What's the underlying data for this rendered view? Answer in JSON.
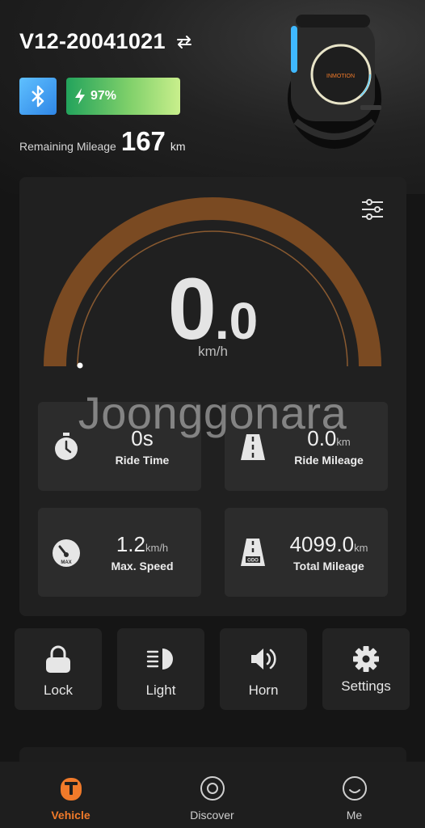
{
  "header": {
    "device_name": "V12-20041021",
    "battery_percent": "97%",
    "remaining_mileage_label": "Remaining Mileage",
    "remaining_mileage_value": "167",
    "remaining_mileage_unit": "km"
  },
  "gauge": {
    "speed_integer": "0",
    "speed_decimal": ".0",
    "speed_unit": "km/h",
    "arc_color": "#7a4a22"
  },
  "stats": [
    {
      "value": "0s",
      "unit": "",
      "label": "Ride Time",
      "icon": "stopwatch-icon"
    },
    {
      "value": "0.0",
      "unit": "km",
      "label": "Ride Mileage",
      "icon": "road-icon"
    },
    {
      "value": "1.2",
      "unit": "km/h",
      "label": "Max. Speed",
      "icon": "speedometer-max-icon"
    },
    {
      "value": "4099.0",
      "unit": "km",
      "label": "Total Mileage",
      "icon": "road-odo-icon"
    }
  ],
  "watermark": "Joonggonara",
  "controls": [
    {
      "label": "Lock",
      "icon": "lock-icon"
    },
    {
      "label": "Light",
      "icon": "headlight-icon"
    },
    {
      "label": "Horn",
      "icon": "horn-icon"
    },
    {
      "label": "Settings",
      "icon": "gear-icon"
    }
  ],
  "nav": [
    {
      "label": "Vehicle",
      "icon": "vehicle-icon",
      "active": true
    },
    {
      "label": "Discover",
      "icon": "discover-icon",
      "active": false
    },
    {
      "label": "Me",
      "icon": "smiley-icon",
      "active": false
    }
  ],
  "colors": {
    "accent": "#f07a2a",
    "bluetooth": "#3a9cf0",
    "battery_start": "#23a35c",
    "battery_end": "#c9ef8c"
  }
}
